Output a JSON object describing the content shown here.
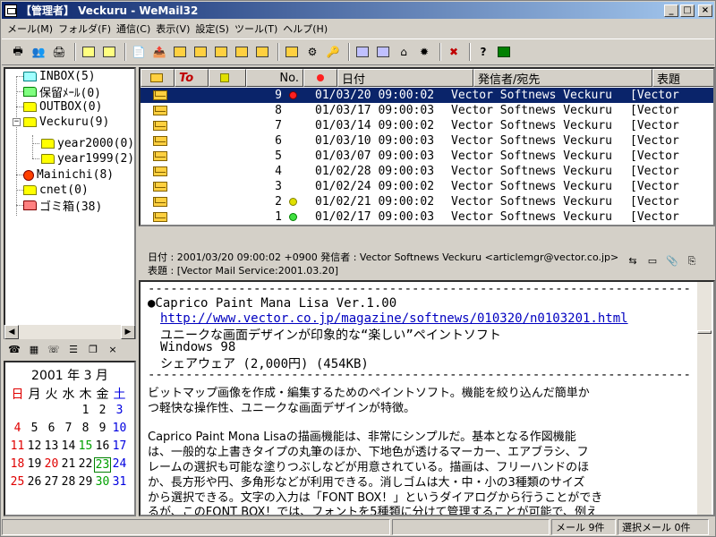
{
  "window": {
    "title": "【管理者】 Veckuru - WeMail32"
  },
  "titlebar": {
    "minimize": "_",
    "maximize": "□",
    "close": "×"
  },
  "menu": [
    "メール(M)",
    "フォルダ(F)",
    "通信(C)",
    "表示(V)",
    "設定(S)",
    "ツール(T)",
    "ヘルプ(H)"
  ],
  "folders": [
    {
      "label": "INBOX(5)",
      "icon": "cyan"
    },
    {
      "label": "保留ﾒｰﾙ(0)",
      "icon": "green"
    },
    {
      "label": "OUTBOX(0)",
      "icon": "yellow"
    },
    {
      "label": "Veckuru(9)",
      "icon": "yellow"
    },
    {
      "label": "year2000(0)",
      "icon": "yellow"
    },
    {
      "label": "year1999(2)",
      "icon": "yellow"
    },
    {
      "label": "Mainichi(8)",
      "icon": "star"
    },
    {
      "label": "cnet(0)",
      "icon": "yellow"
    },
    {
      "label": "ゴミ箱(38)",
      "icon": "trash"
    }
  ],
  "calendar": {
    "title": "2001 年 3 月",
    "weekdays": [
      "日",
      "月",
      "火",
      "水",
      "木",
      "金",
      "土"
    ],
    "weeks": [
      [
        "",
        "",
        "",
        "",
        "1",
        "2",
        "3"
      ],
      [
        "4",
        "5",
        "6",
        "7",
        "8",
        "9",
        "10"
      ],
      [
        "11",
        "12",
        "13",
        "14",
        "15",
        "16",
        "17"
      ],
      [
        "18",
        "19",
        "20",
        "21",
        "22",
        "23",
        "24"
      ],
      [
        "25",
        "26",
        "27",
        "28",
        "29",
        "30",
        "31"
      ]
    ]
  },
  "list": {
    "headers": {
      "to": "To",
      "no": "No.",
      "date": "日付",
      "from": "発信者/宛先",
      "subject": "表題"
    },
    "rows": [
      {
        "no": "9",
        "date": "01/03/20 09:00:02",
        "from": "Vector Softnews Veckuru",
        "subject": "[Vector",
        "mark": "red"
      },
      {
        "no": "8",
        "date": "01/03/17 09:00:03",
        "from": "Vector Softnews Veckuru",
        "subject": "[Vector",
        "mark": ""
      },
      {
        "no": "7",
        "date": "01/03/14 09:00:02",
        "from": "Vector Softnews Veckuru",
        "subject": "[Vector",
        "mark": ""
      },
      {
        "no": "6",
        "date": "01/03/10 09:00:03",
        "from": "Vector Softnews Veckuru",
        "subject": "[Vector",
        "mark": ""
      },
      {
        "no": "5",
        "date": "01/03/07 09:00:03",
        "from": "Vector Softnews Veckuru",
        "subject": "[Vector",
        "mark": ""
      },
      {
        "no": "4",
        "date": "01/02/28 09:00:03",
        "from": "Vector Softnews Veckuru",
        "subject": "[Vector",
        "mark": ""
      },
      {
        "no": "3",
        "date": "01/02/24 09:00:02",
        "from": "Vector Softnews Veckuru",
        "subject": "[Vector",
        "mark": ""
      },
      {
        "no": "2",
        "date": "01/02/21 09:00:02",
        "from": "Vector Softnews Veckuru",
        "subject": "[Vector",
        "mark": "yellow"
      },
      {
        "no": "1",
        "date": "01/02/17 09:00:03",
        "from": "Vector Softnews Veckuru",
        "subject": "[Vector",
        "mark": "green"
      }
    ]
  },
  "header_info": {
    "line1": "日付 : 2001/03/20 09:00:02 +0900   発信者 : Vector Softnews Veckuru <articlemgr@vector.co.jp>",
    "line2": "表題 : [Vector Mail Service:2001.03.20]"
  },
  "body": {
    "lines": [
      {
        "text": "------------------------------------------------------------------------",
        "style": "mono"
      },
      {
        "text": "●Caprico Paint Mana Lisa Ver.1.00",
        "style": "mono"
      },
      {
        "text": "http://www.vector.co.jp/magazine/softnews/010320/n0103201.html",
        "style": "link"
      },
      {
        "text": "ユニークな画面デザインが印象的な“楽しい”ペイントソフト",
        "style": "mono"
      },
      {
        "text": "Windows 98",
        "style": "mono"
      },
      {
        "text": "シェアウェア (2,000円)   (454KB)",
        "style": "mono"
      },
      {
        "text": "------------------------------------------------------------------------",
        "style": "mono"
      },
      {
        "text": "ビットマップ画像を作成・編集するためのペイントソフト。機能を絞り込んだ簡単か",
        "style": "prop"
      },
      {
        "text": "つ軽快な操作性、ユニークな画面デザインが特徴。",
        "style": "prop"
      },
      {
        "text": "",
        "style": "prop"
      },
      {
        "text": "Caprico Paint Mona Lisaの描画機能は、非常にシンプルだ。基本となる作図機能",
        "style": "prop"
      },
      {
        "text": "は、一般的な上書きタイプの丸筆のほか、下地色が透けるマーカー、エアブラシ、フ",
        "style": "prop"
      },
      {
        "text": "レームの選択も可能な塗りつぶしなどが用意されている。描画は、フリーハンドのほ",
        "style": "prop"
      },
      {
        "text": "か、長方形や円、多角形などが利用できる。消しゴムは大・中・小の3種類のサイズ",
        "style": "prop"
      },
      {
        "text": "から選択できる。文字の入力は「FONT BOX！」というダイアログから行うことができ",
        "style": "prop"
      },
      {
        "text": "るが、このFONT BOX！では、フォントを5種類に分けて管理することが可能で、例え",
        "style": "prop"
      }
    ]
  },
  "status": {
    "mail_count": "メール  9件",
    "selected": "選択メール  0件"
  }
}
